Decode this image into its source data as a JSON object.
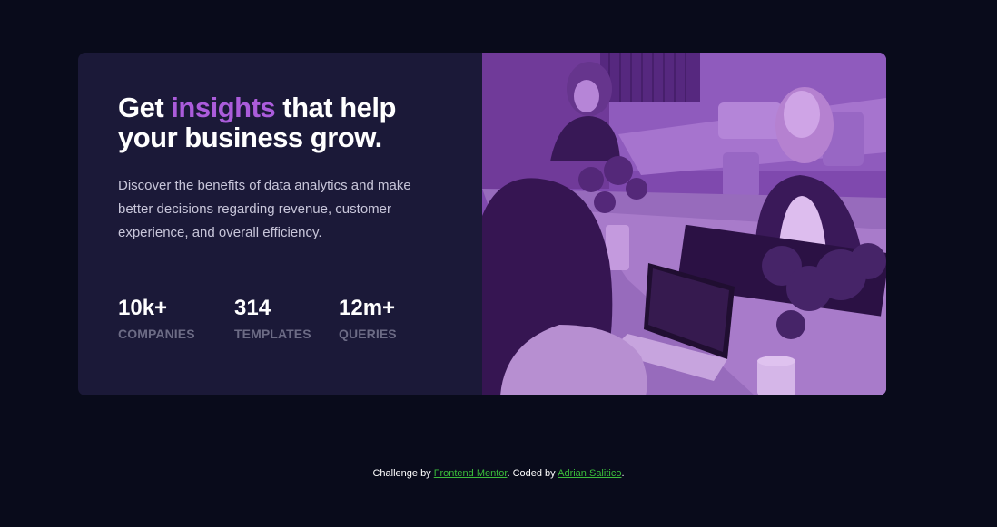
{
  "card": {
    "headline": {
      "part1": "Get ",
      "accent": "insights",
      "part2": " that help your business grow."
    },
    "description": "Discover the benefits of data analytics and make better decisions regarding revenue, customer experience, and overall efficiency.",
    "stats": [
      {
        "value": "10k+",
        "label": "COMPANIES"
      },
      {
        "value": "314",
        "label": "TEMPLATES"
      },
      {
        "value": "12m+",
        "label": "QUERIES"
      }
    ]
  },
  "footer": {
    "prefix": "Challenge by ",
    "link1": "Frontend Mentor",
    "middle": ". Coded by ",
    "link2": "Adrian Salitico",
    "suffix": "."
  },
  "colors": {
    "page_bg": "#090b1b",
    "card_bg": "#1b1938",
    "accent": "#ab5cdb",
    "image_tint": "#7d4aa8",
    "link": "#3bbd3b"
  }
}
